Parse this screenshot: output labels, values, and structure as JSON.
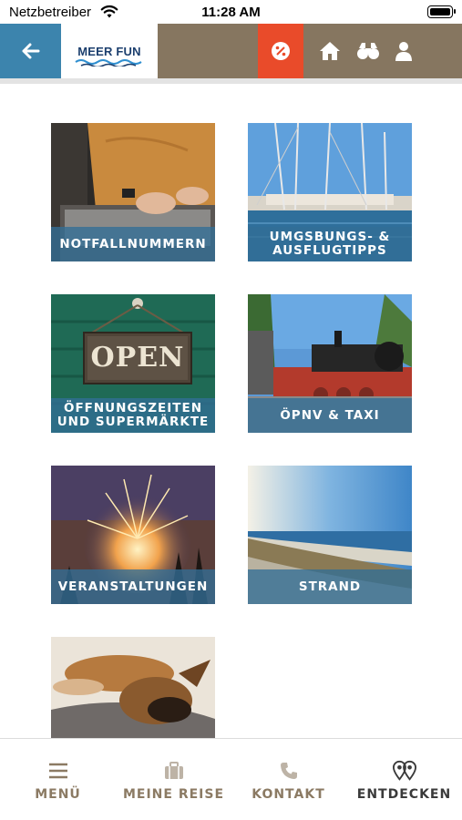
{
  "status_bar": {
    "carrier": "Netzbetreiber",
    "time": "11:28 AM"
  },
  "header": {
    "logo_text": "MEER FUN",
    "icons": [
      "back-arrow-icon",
      "percent-badge-icon",
      "home-icon",
      "binoculars-icon",
      "person-icon"
    ]
  },
  "tiles": [
    {
      "label": "NOTFALLNUMMERN"
    },
    {
      "label": "UMGSBUNGS- &\nAUSFLUGTIPPS"
    },
    {
      "label": "ÖFFNUNGSZEITEN\nUND SUPERMÄRKTE",
      "sign_text": "OPEN"
    },
    {
      "label": "ÖPNV & TAXI"
    },
    {
      "label": "VERANSTALTUNGEN"
    },
    {
      "label": "STRAND"
    },
    {
      "label": ""
    }
  ],
  "bottom_nav": {
    "items": [
      {
        "label": "MENÜ",
        "icon": "hamburger-menu-icon",
        "active": false
      },
      {
        "label": "MEINE REISE",
        "icon": "suitcase-icon",
        "active": false
      },
      {
        "label": "KONTAKT",
        "icon": "phone-icon",
        "active": false
      },
      {
        "label": "ENTDECKEN",
        "icon": "map-pins-icon",
        "active": true
      }
    ]
  },
  "colors": {
    "header_brown": "#867660",
    "back_blue": "#3c84ad",
    "promo_red": "#e94b2a",
    "tile_band": "#326e96",
    "nav_inactive": "#8b7a63",
    "nav_active": "#3a3a3a"
  }
}
